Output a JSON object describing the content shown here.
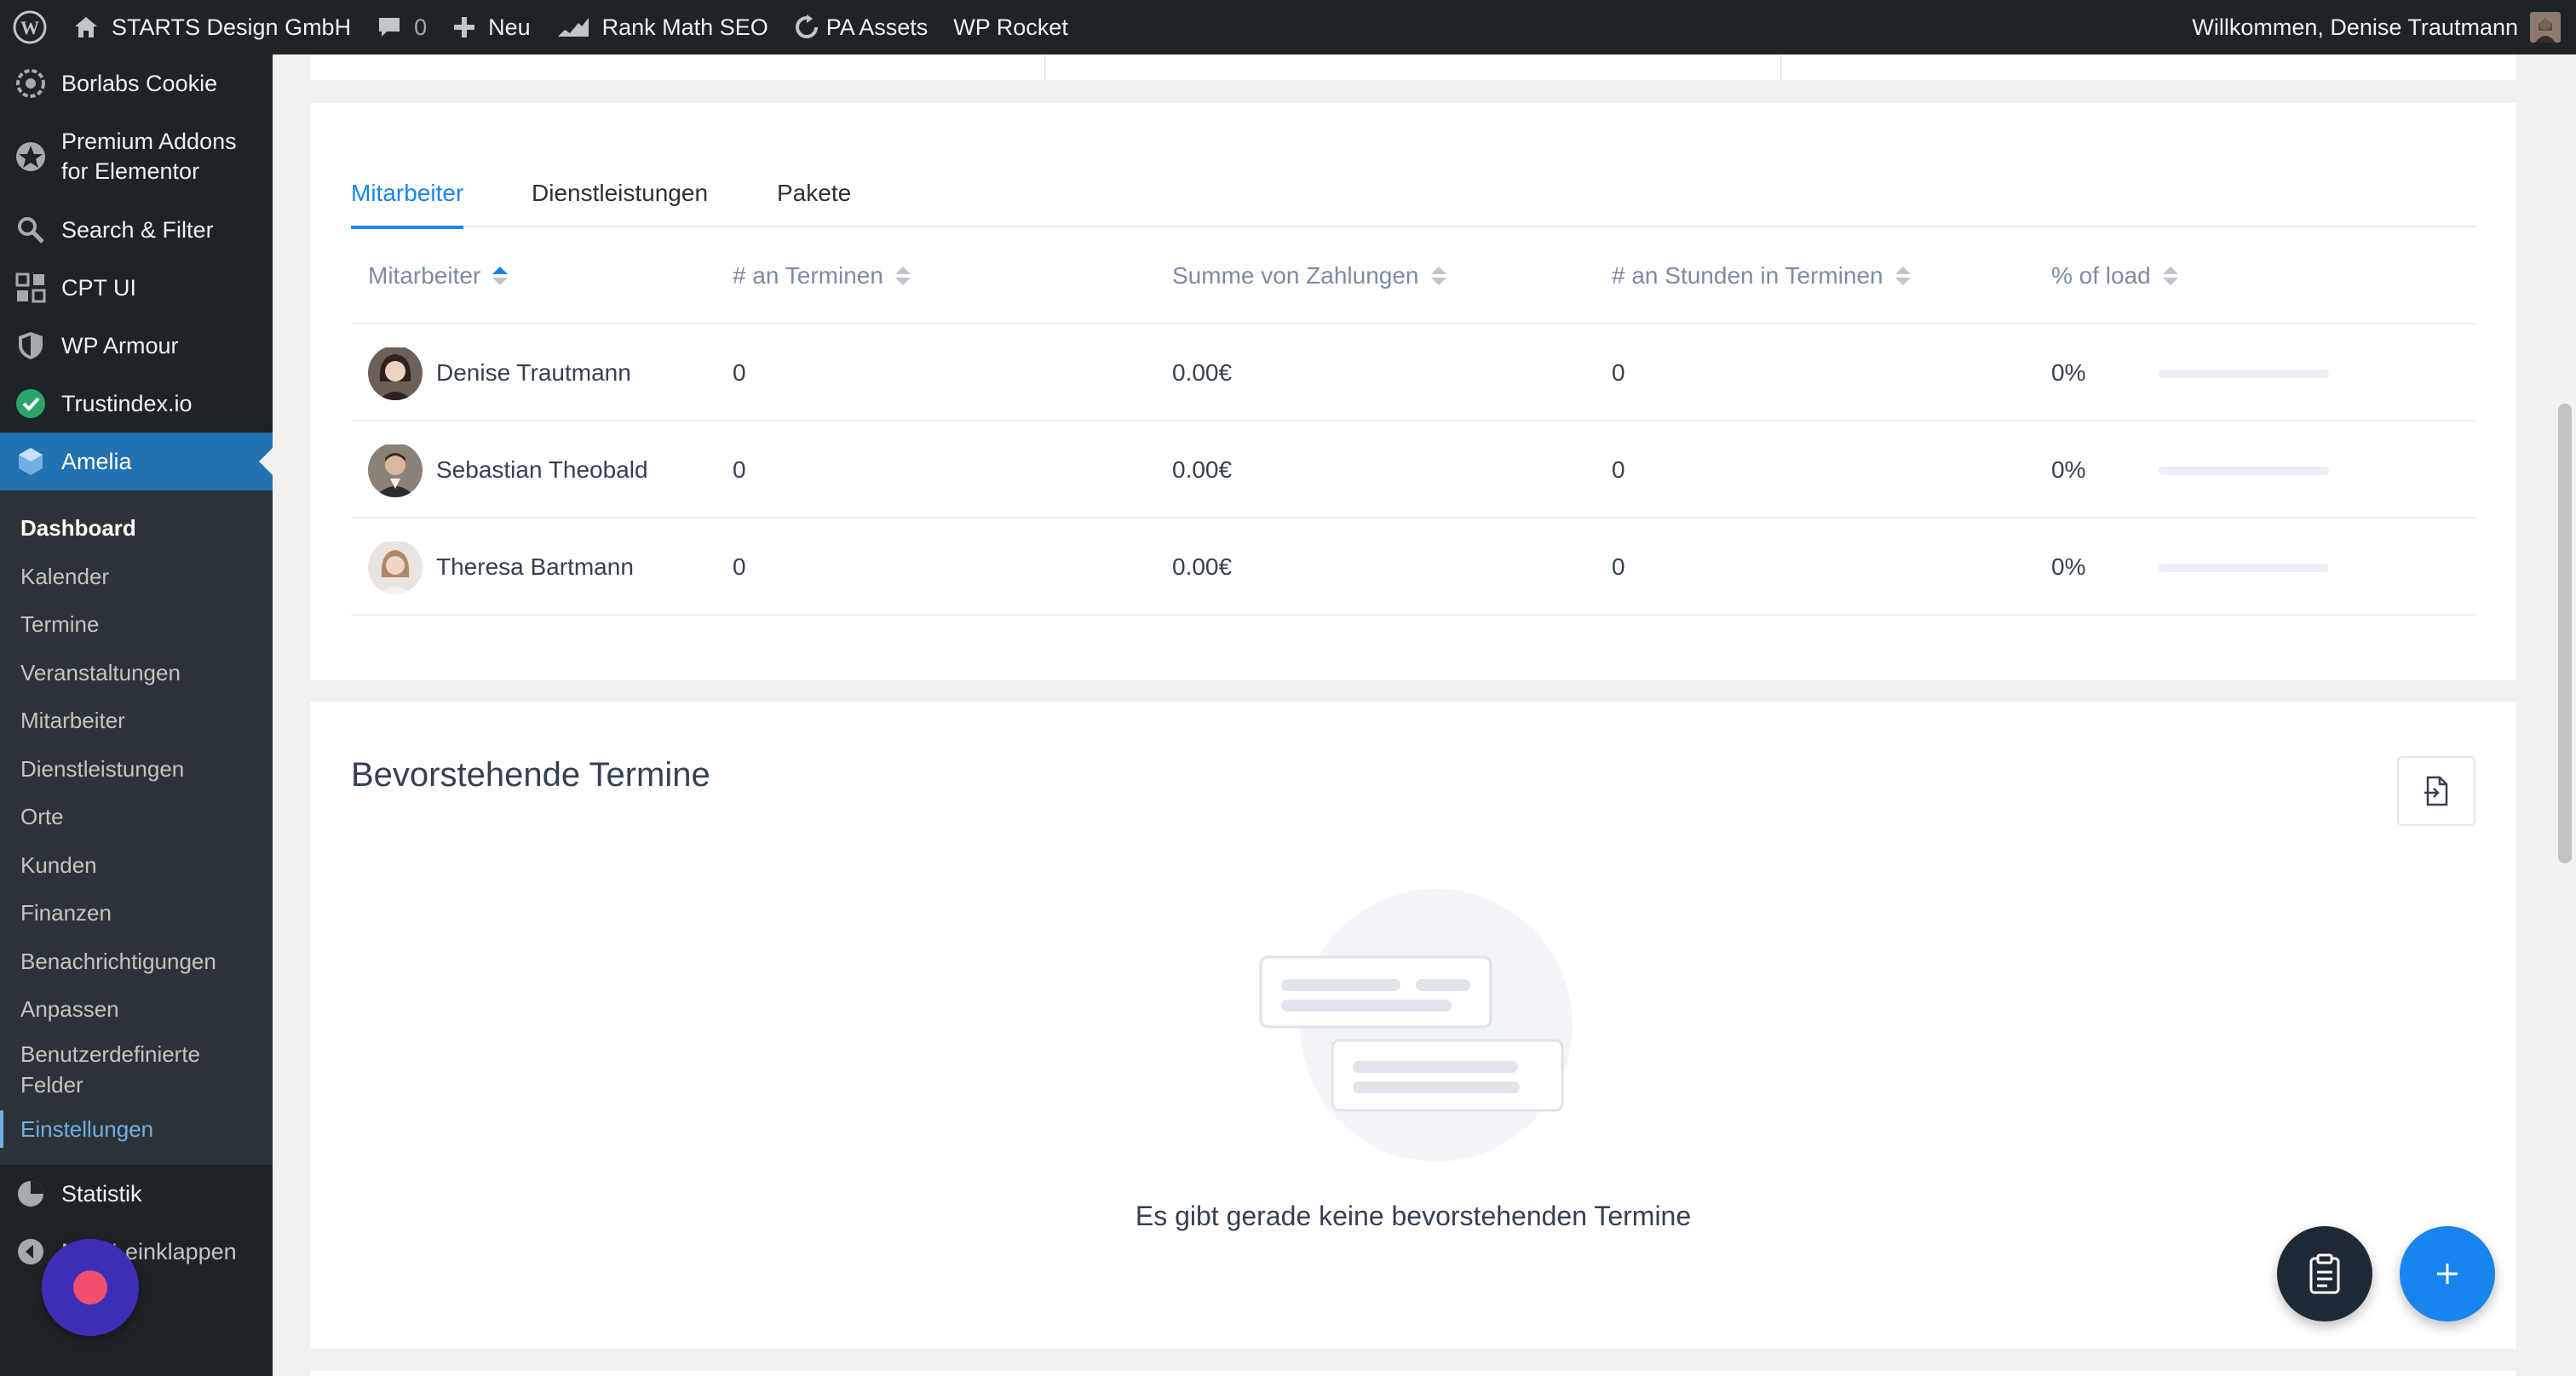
{
  "adminbar": {
    "site_name": "STARTS Design GmbH",
    "comments_count": "0",
    "new_label": "Neu",
    "rank_math": "Rank Math SEO",
    "pa_assets": "PA Assets",
    "wp_rocket": "WP Rocket",
    "greeting": "Willkommen, Denise Trautmann"
  },
  "sidebar": {
    "top_items": [
      {
        "label": "Borlabs Cookie",
        "icon": "cookie-icon"
      },
      {
        "label": "Premium Addons for Elementor",
        "icon": "premium-addons-icon"
      },
      {
        "label": "Search & Filter",
        "icon": "search-icon"
      },
      {
        "label": "CPT UI",
        "icon": "cpt-ui-icon"
      },
      {
        "label": "WP Armour",
        "icon": "shield-icon"
      },
      {
        "label": "Trustindex.io",
        "icon": "trustindex-icon"
      },
      {
        "label": "Amelia",
        "icon": "amelia-icon"
      }
    ],
    "sub_items": [
      "Dashboard",
      "Kalender",
      "Termine",
      "Veranstaltungen",
      "Mitarbeiter",
      "Dienstleistungen",
      "Orte",
      "Kunden",
      "Finanzen",
      "Benachrichtigungen",
      "Anpassen",
      "Benutzerdefinierte Felder",
      "Einstellungen"
    ],
    "bottom_items": [
      {
        "label": "Statistik",
        "icon": "pie-chart-icon"
      },
      {
        "label": "Menü einklappen",
        "icon": "collapse-icon"
      }
    ]
  },
  "tabs": [
    "Mitarbeiter",
    "Dienstleistungen",
    "Pakete"
  ],
  "employee_table": {
    "headers": [
      "Mitarbeiter",
      "# an Terminen",
      "Summe von Zahlungen",
      "# an Stunden in Terminen",
      "% of load"
    ],
    "rows": [
      {
        "name": "Denise Trautmann",
        "appointments": "0",
        "payments": "0.00€",
        "hours": "0",
        "load": "0%",
        "load_value": 0
      },
      {
        "name": "Sebastian Theobald",
        "appointments": "0",
        "payments": "0.00€",
        "hours": "0",
        "load": "0%",
        "load_value": 0
      },
      {
        "name": "Theresa Bartmann",
        "appointments": "0",
        "payments": "0.00€",
        "hours": "0",
        "load": "0%",
        "load_value": 0
      }
    ]
  },
  "upcoming": {
    "title": "Bevorstehende Termine",
    "empty_message": "Es gibt gerade keine bevorstehenden Termine"
  },
  "colors": {
    "accent": "#1a84ee",
    "admin_bg": "#1d2327",
    "active_menu": "#2271b1"
  }
}
